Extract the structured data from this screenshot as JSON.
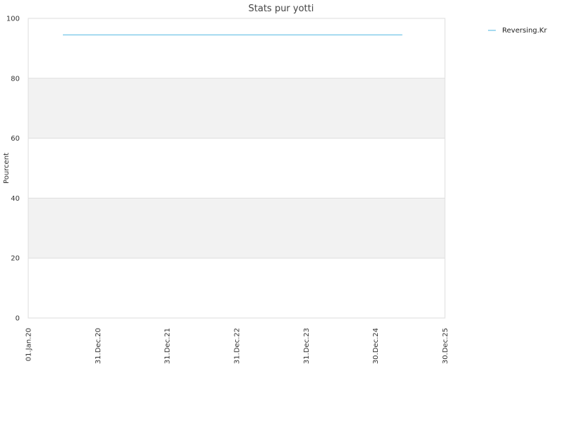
{
  "chart_data": {
    "type": "line",
    "title": "Stats pur yotti",
    "xlabel": "",
    "ylabel": "Pourcent",
    "x_type": "date",
    "x_ticks": [
      {
        "date": "2020-01-01",
        "label": "01.Jan.20"
      },
      {
        "date": "2020-12-31",
        "label": "31.Dec.20"
      },
      {
        "date": "2021-12-31",
        "label": "31.Dec.21"
      },
      {
        "date": "2022-12-31",
        "label": "31.Dec.22"
      },
      {
        "date": "2023-12-31",
        "label": "31.Dec.23"
      },
      {
        "date": "2024-12-30",
        "label": "30.Dec.24"
      },
      {
        "date": "2025-12-30",
        "label": "30.Dec.25"
      }
    ],
    "xlim": [
      "2020-01-01",
      "2025-12-30"
    ],
    "ylim": [
      0,
      100
    ],
    "y_ticks": [
      0,
      20,
      40,
      60,
      80,
      100
    ],
    "grid": true,
    "legend_position": "top-right",
    "series": [
      {
        "name": "Reversing.Kr",
        "color": "#87CEEB",
        "x": [
          "2020-07-01",
          "2025-05-20"
        ],
        "y": [
          94.5,
          94.5
        ]
      }
    ]
  }
}
